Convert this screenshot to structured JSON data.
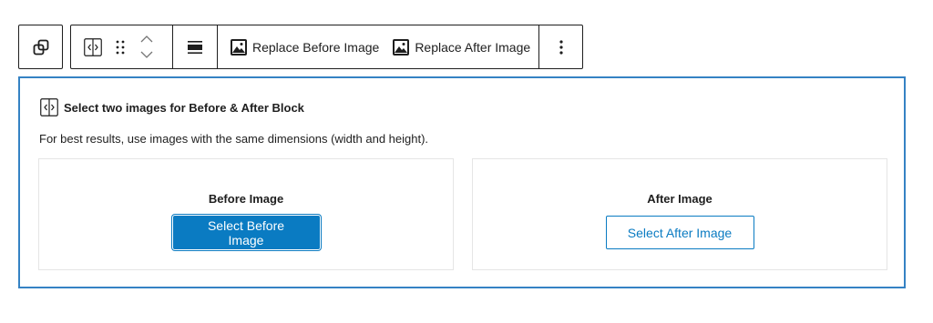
{
  "toolbar": {
    "transform_icon": "duplicate-squares-icon",
    "block_icon": "before-after-icon",
    "drag_icon": "drag-handle-icon",
    "move_up_icon": "chevron-up-icon",
    "move_down_icon": "chevron-down-icon",
    "align_icon": "align-justify-icon",
    "replace_before_label": "Replace Before Image",
    "replace_after_label": "Replace After Image",
    "replace_icon": "image-icon",
    "more_icon": "more-vertical-icon"
  },
  "block": {
    "title": "Select two images for Before & After Block",
    "description": "For best results, use images with the same dimensions (width and height).",
    "before": {
      "heading": "Before Image",
      "button_label": "Select Before Image"
    },
    "after": {
      "heading": "After Image",
      "button_label": "Select After Image"
    }
  },
  "colors": {
    "accent": "#0a7bc2",
    "selection_border": "#3582c4",
    "text": "#1e1e1e"
  }
}
